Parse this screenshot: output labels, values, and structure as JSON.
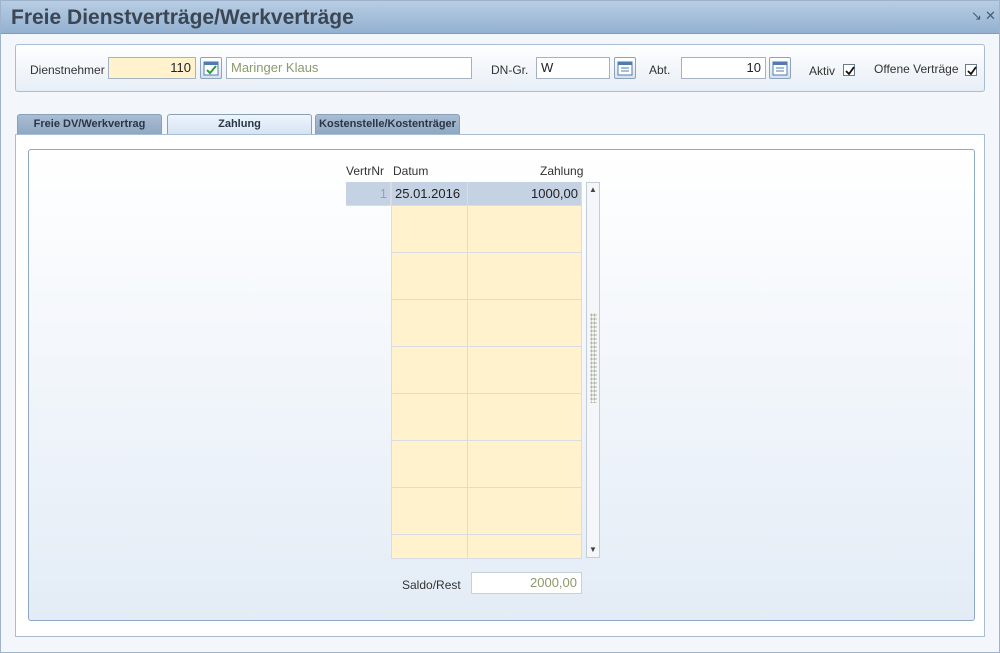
{
  "window": {
    "title": "Freie Dienstverträge/Werkverträge"
  },
  "filter": {
    "dienstnehmer_label": "Dienstnehmer",
    "dienstnehmer_value": "110",
    "dienstnehmer_name": "Maringer Klaus",
    "dngr_label": "DN-Gr.",
    "dngr_value": "W",
    "abt_label": "Abt.",
    "abt_value": "10",
    "aktiv_label": "Aktiv",
    "aktiv_checked": true,
    "offene_label": "Offene Verträge",
    "offene_checked": true
  },
  "tabs": [
    {
      "label": "Freie DV/Werkvertrag",
      "active": false
    },
    {
      "label": "Zahlung",
      "active": true
    },
    {
      "label": "Kostenstelle/Kostenträger",
      "active": false
    }
  ],
  "table": {
    "columns": [
      "VertrNr",
      "Datum",
      "Zahlung"
    ],
    "rows": [
      {
        "vertrnr": "1",
        "datum": "25.01.2016",
        "zahlung": "1000,00"
      }
    ],
    "empty_rows": 15
  },
  "saldo": {
    "label": "Saldo/Rest",
    "value": "2000,00"
  },
  "colors": {
    "accent": "#93b1d1",
    "field_yellow": "#fff2cc",
    "selection": "#c5d2e3"
  }
}
